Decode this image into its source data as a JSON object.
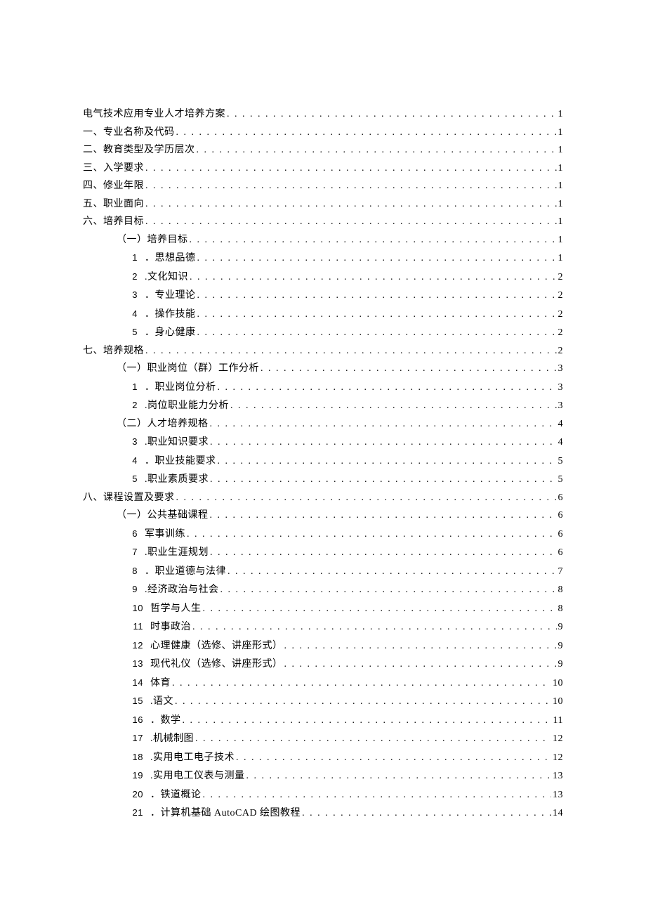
{
  "toc": [
    {
      "level": 0,
      "num": "",
      "title": "电气技术应用专业人才培养方案",
      "page": "1"
    },
    {
      "level": 0,
      "num": "",
      "title": "一、专业名称及代码",
      "page": "1"
    },
    {
      "level": 0,
      "num": "",
      "title": "二、教育类型及学历层次",
      "page": "1"
    },
    {
      "level": 0,
      "num": "",
      "title": "三、入学要求",
      "page": "1"
    },
    {
      "level": 0,
      "num": "",
      "title": "四、修业年限",
      "page": "1"
    },
    {
      "level": 0,
      "num": "",
      "title": "五、职业面向",
      "page": "1"
    },
    {
      "level": 0,
      "num": "",
      "title": "六、培养目标",
      "page": "1"
    },
    {
      "level": 1,
      "num": "",
      "title": "（一）培养目标",
      "page": "1"
    },
    {
      "level": 2,
      "num": "1",
      "title": "．思想品德",
      "page": "1"
    },
    {
      "level": 2,
      "num": "2",
      "title": ".文化知识",
      "page": "2"
    },
    {
      "level": 2,
      "num": "3",
      "title": "．专业理论",
      "page": "2"
    },
    {
      "level": 2,
      "num": "4",
      "title": "．操作技能",
      "page": "2"
    },
    {
      "level": 2,
      "num": "5",
      "title": "．身心健康",
      "page": "2"
    },
    {
      "level": 0,
      "num": "",
      "title": "七、培养规格",
      "page": "2"
    },
    {
      "level": 1,
      "num": "",
      "title": "（一）职业岗位（群）工作分析",
      "page": "3"
    },
    {
      "level": 2,
      "num": "1",
      "title": "．职业岗位分析",
      "page": "3"
    },
    {
      "level": 2,
      "num": "2",
      "title": ".岗位职业能力分析",
      "page": "3"
    },
    {
      "level": 1,
      "num": "",
      "title": "（二）人才培养规格",
      "page": "4"
    },
    {
      "level": 2,
      "num": "3",
      "title": ".职业知识要求",
      "page": "4"
    },
    {
      "level": 2,
      "num": "4",
      "title": "．职业技能要求",
      "page": "5"
    },
    {
      "level": 2,
      "num": "5",
      "title": ".职业素质要求",
      "page": "5"
    },
    {
      "level": 0,
      "num": "",
      "title": "八、课程设置及要求",
      "page": "6"
    },
    {
      "level": 1,
      "num": "",
      "title": "（一）公共基础课程",
      "page": "6"
    },
    {
      "level": 2,
      "num": "6",
      "title": "军事训练",
      "page": "6"
    },
    {
      "level": 2,
      "num": "7",
      "title": ".职业生涯规划",
      "page": "6"
    },
    {
      "level": 2,
      "num": "8",
      "title": "．职业道德与法律",
      "page": "7"
    },
    {
      "level": 2,
      "num": "9",
      "title": ".经济政治与社会",
      "page": "8"
    },
    {
      "level": 2,
      "num": "10",
      "title": "哲学与人生",
      "page": "8"
    },
    {
      "level": 2,
      "num": "11",
      "title": "时事政治",
      "page": "9"
    },
    {
      "level": 2,
      "num": "12",
      "title": "心理健康（选修、讲座形式）",
      "page": "9"
    },
    {
      "level": 2,
      "num": "13",
      "title": "现代礼仪（选修、讲座形式）",
      "page": "9"
    },
    {
      "level": 2,
      "num": "14",
      "title": "体育",
      "page": "10"
    },
    {
      "level": 2,
      "num": "15",
      "title": ".语文",
      "page": "10"
    },
    {
      "level": 2,
      "num": "16",
      "title": "．数学",
      "page": "11"
    },
    {
      "level": 2,
      "num": "17",
      "title": ".机械制图",
      "page": "12"
    },
    {
      "level": 2,
      "num": "18",
      "title": ".实用电工电子技术",
      "page": "12"
    },
    {
      "level": 2,
      "num": "19",
      "title": ".实用电工仪表与测量",
      "page": "13"
    },
    {
      "level": 2,
      "num": "20",
      "title": "．铁道概论",
      "page": "13"
    },
    {
      "level": 2,
      "num": "21",
      "title": "．计算机基础 AutoCAD 绘图教程",
      "page": "14"
    }
  ]
}
